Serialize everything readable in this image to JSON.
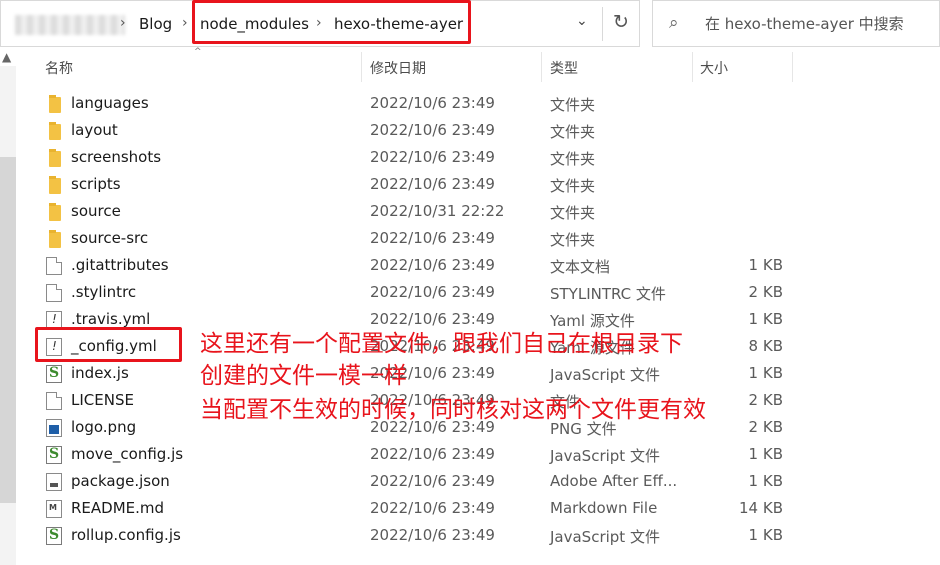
{
  "address_bar": {
    "crumbs": [
      "Blog",
      "node_modules",
      "hexo-theme-ayer"
    ]
  },
  "search": {
    "placeholder": "在 hexo-theme-ayer 中搜索"
  },
  "columns": {
    "name": "名称",
    "date": "修改日期",
    "type": "类型",
    "size": "大小"
  },
  "files": [
    {
      "name": "languages",
      "date": "2022/10/6 23:49",
      "type": "文件夹",
      "size": "",
      "icon": "folder-icon"
    },
    {
      "name": "layout",
      "date": "2022/10/6 23:49",
      "type": "文件夹",
      "size": "",
      "icon": "folder-icon"
    },
    {
      "name": "screenshots",
      "date": "2022/10/6 23:49",
      "type": "文件夹",
      "size": "",
      "icon": "folder-icon"
    },
    {
      "name": "scripts",
      "date": "2022/10/6 23:49",
      "type": "文件夹",
      "size": "",
      "icon": "folder-icon"
    },
    {
      "name": "source",
      "date": "2022/10/31 22:22",
      "type": "文件夹",
      "size": "",
      "icon": "folder-icon"
    },
    {
      "name": "source-src",
      "date": "2022/10/6 23:49",
      "type": "文件夹",
      "size": "",
      "icon": "folder-icon"
    },
    {
      "name": ".gitattributes",
      "date": "2022/10/6 23:49",
      "type": "文本文档",
      "size": "1 KB",
      "icon": "text-file-icon"
    },
    {
      "name": ".stylintrc",
      "date": "2022/10/6 23:49",
      "type": "STYLINTRC 文件",
      "size": "2 KB",
      "icon": "blank-file-icon"
    },
    {
      "name": ".travis.yml",
      "date": "2022/10/6 23:49",
      "type": "Yaml 源文件",
      "size": "1 KB",
      "icon": "yaml-file-icon"
    },
    {
      "name": "_config.yml",
      "date": "2022/10/6 23:49",
      "type": "Yaml 源文件",
      "size": "8 KB",
      "icon": "yaml-file-icon"
    },
    {
      "name": "index.js",
      "date": "2022/10/6 23:49",
      "type": "JavaScript 文件",
      "size": "1 KB",
      "icon": "js-file-icon"
    },
    {
      "name": "LICENSE",
      "date": "2022/10/6 23:49",
      "type": "文件",
      "size": "2 KB",
      "icon": "blank-file-icon"
    },
    {
      "name": "logo.png",
      "date": "2022/10/6 23:49",
      "type": "PNG 文件",
      "size": "2 KB",
      "icon": "png-file-icon"
    },
    {
      "name": "move_config.js",
      "date": "2022/10/6 23:49",
      "type": "JavaScript 文件",
      "size": "1 KB",
      "icon": "js-file-icon"
    },
    {
      "name": "package.json",
      "date": "2022/10/6 23:49",
      "type": "Adobe After Eff...",
      "size": "1 KB",
      "icon": "json-file-icon"
    },
    {
      "name": "README.md",
      "date": "2022/10/6 23:49",
      "type": "Markdown File",
      "size": "14 KB",
      "icon": "markdown-file-icon"
    },
    {
      "name": "rollup.config.js",
      "date": "2022/10/6 23:49",
      "type": "JavaScript 文件",
      "size": "1 KB",
      "icon": "js-file-icon"
    }
  ],
  "annotation": {
    "line1": "这里还有一个配置文件，跟我们自己在根目录下",
    "line2": "创建的文件一模一样",
    "line3": "当配置不生效的时候，同时核对这两个文件更有效",
    "color": "#e8141c"
  }
}
